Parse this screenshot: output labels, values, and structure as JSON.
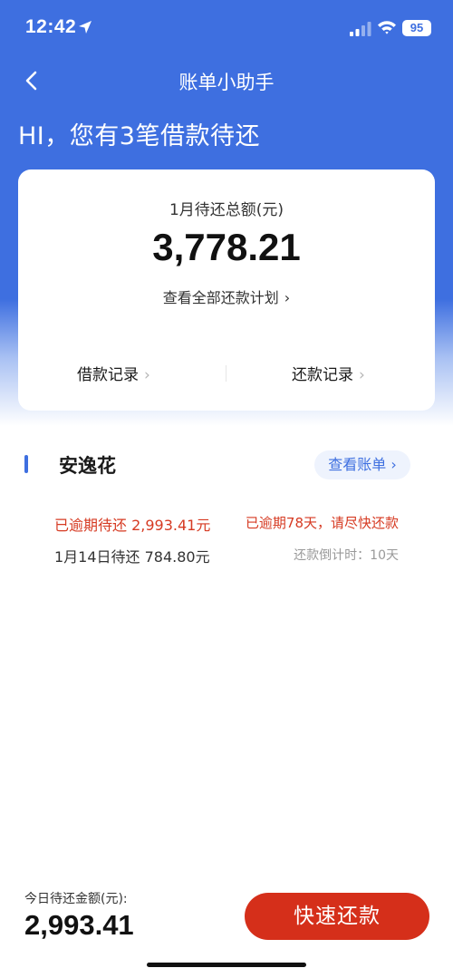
{
  "status_bar": {
    "time": "12:42",
    "battery": "95"
  },
  "nav": {
    "title": "账单小助手"
  },
  "greeting": "HI，您有3笔借款待还",
  "summary": {
    "label": "1月待还总额(元)",
    "amount": "3,778.21",
    "plan_link": "查看全部还款计划",
    "loan_records": "借款记录",
    "repay_records": "还款记录"
  },
  "product": {
    "name": "安逸花",
    "view_bill": "查看账单",
    "overdue_amount": "已逾期待还 2,993.41元",
    "overdue_note": "已逾期78天，请尽快还款",
    "due_amount": "1月14日待还 784.80元",
    "countdown": "还款倒计时：10天"
  },
  "footer": {
    "label": "今日待还金额(元):",
    "amount": "2,993.41",
    "quick_pay": "快速还款"
  },
  "colors": {
    "brand_blue": "#3e6fe0",
    "alert_red": "#d63a22",
    "pay_button": "#d52f1a"
  },
  "icons": {
    "location": "location-arrow-icon",
    "signal": "cellular-signal-icon",
    "wifi": "wifi-icon",
    "back": "chevron-left-icon",
    "chevron": "chevron-right-icon"
  }
}
